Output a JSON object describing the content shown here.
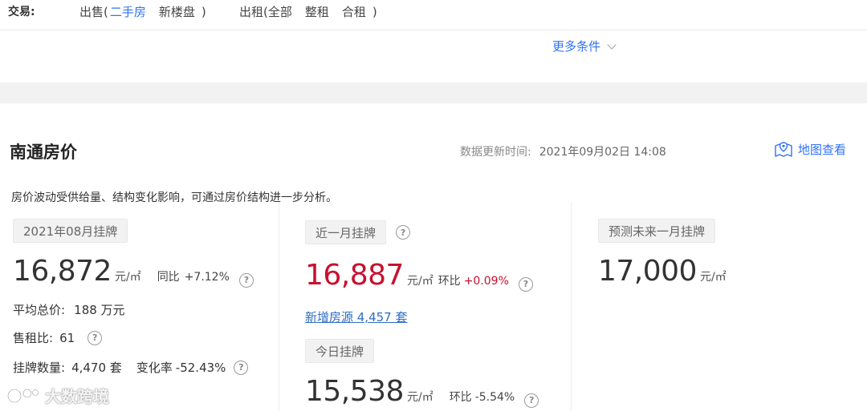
{
  "filters": {
    "label": "交易:",
    "sale": {
      "prefix": "出售(",
      "options": [
        "二手房",
        "新楼盘"
      ],
      "suffix": ")"
    },
    "rent": {
      "prefix": "出租(",
      "options": [
        "全部",
        "整租",
        "合租"
      ],
      "suffix": ")"
    },
    "more_label": "更多条件",
    "accent_color": "#3072f6"
  },
  "section": {
    "title": "南通房价",
    "updated_label": "数据更新时间:",
    "updated_value": "2021年09月02日 14:08",
    "map_link": "地图查看",
    "description": "房价波动受供给量、结构变化影响，可通过房价结构进一步分析。"
  },
  "col1": {
    "tag": "2021年08月挂牌",
    "price": "16,872",
    "unit": "元/㎡",
    "yoy_label": "同比",
    "yoy_value": "+7.12%",
    "avg_total_label": "平均总价:",
    "avg_total_value": "188 万元",
    "rent_ratio_label": "售租比:",
    "rent_ratio_value": "61",
    "listing_label": "挂牌数量:",
    "listing_value": "4,470 套",
    "change_label": "变化率",
    "change_value": "-52.43%"
  },
  "col2": {
    "tag": "近一月挂牌",
    "price": "16,887",
    "unit": "元/㎡",
    "mom_label": "环比",
    "mom_value": "+0.09%",
    "new_listings": "新增房源 4,457 套",
    "today_tag": "今日挂牌",
    "today_price": "15,538",
    "today_unit": "元/㎡",
    "today_mom_label": "环比",
    "today_mom_value": "-5.54%"
  },
  "col3": {
    "tag": "预测未来一月挂牌",
    "price": "17,000",
    "unit": "元/㎡"
  },
  "watermark": "大数跨境",
  "help_glyph": "?"
}
